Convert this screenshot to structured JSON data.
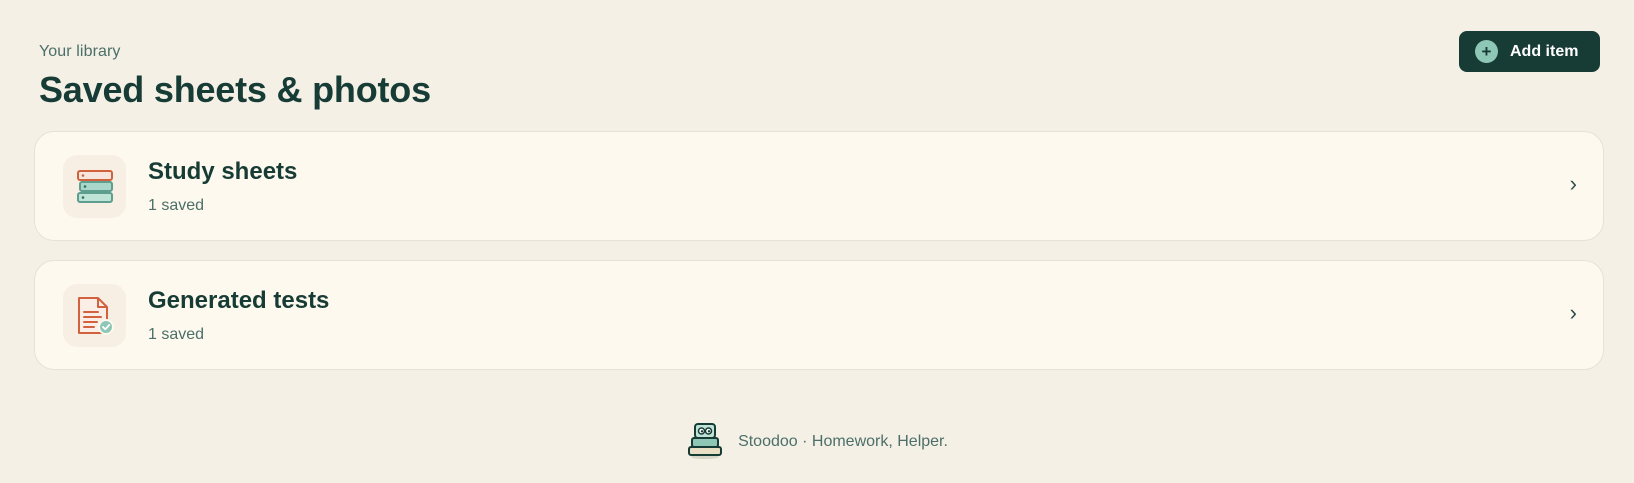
{
  "header": {
    "eyebrow": "Your library",
    "title": "Saved sheets & photos",
    "add_button_label": "Add item",
    "add_button_icon": "plus-circle-icon"
  },
  "items": [
    {
      "title": "Study sheets",
      "count": "1 saved",
      "icon": "stacked-sheets-icon",
      "chevron": "›"
    },
    {
      "title": "Generated tests",
      "count": "1 saved",
      "icon": "test-document-check-icon",
      "chevron": "›"
    }
  ],
  "footer": {
    "text": "Stoodoo · Homework, Helper.",
    "logo_icon": "stoodoo-logo-icon"
  },
  "colors": {
    "background": "#f4f0e6",
    "card_background": "#fdf9ee",
    "primary_dark": "#173b35",
    "accent_teal": "#8fc7b7",
    "accent_orange": "#d2623d"
  }
}
